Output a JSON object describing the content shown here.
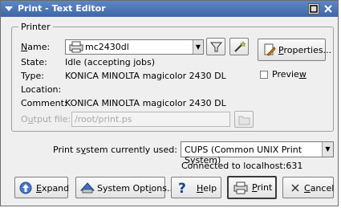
{
  "window": {
    "title": "Print - Text Editor",
    "icons": {
      "menu": "chevron-down-icon",
      "maximize": "maximize-icon",
      "close": "close-icon"
    }
  },
  "printer_group": {
    "title": "Printer",
    "name_label": "Name:",
    "name_value": "mc2430dl",
    "state_label": "State:",
    "state_value": "Idle (accepting jobs)",
    "type_label": "Type:",
    "type_value": "KONICA MINOLTA magicolor 2430 DL",
    "location_label": "Location:",
    "location_value": "",
    "comment_label": "Comment:",
    "comment_value": "KONICA MINOLTA magicolor 2430 DL",
    "output_file_label": "Output file:",
    "output_file_value": "/root/print.ps",
    "properties_label": "Properties...",
    "preview_label": "Preview",
    "preview_checked": false
  },
  "print_system": {
    "label": "Print system currently used:",
    "value": "CUPS (Common UNIX Print System)",
    "status": "Connected to localhost:631"
  },
  "buttons": {
    "expand": "Expand",
    "system_options": "System Options...",
    "help": "Help",
    "print": "Print",
    "cancel": "Cancel"
  },
  "colors": {
    "titlebar": "#4f77b8",
    "window_bg": "#efefef"
  }
}
